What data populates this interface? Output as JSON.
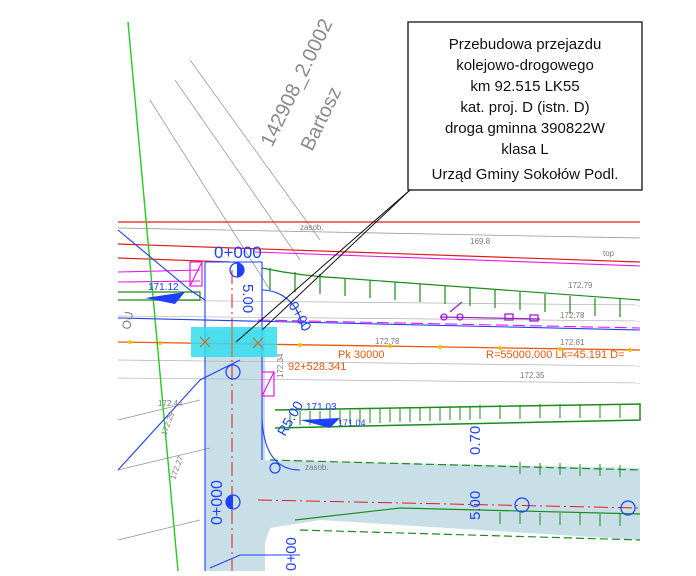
{
  "title_block": {
    "lines": [
      "Przebudowa przejazdu",
      "kolejowo-drogowego",
      "km 92.515 LK55",
      "kat. proj. D (istn. D)",
      "droga gminna 390822W",
      "klasa L",
      "Urząd Gminy Sokołów Podl."
    ]
  },
  "labels": {
    "parcel_number": "142908_2.0002",
    "parcel_owner": "Bartosz",
    "chainage_top": "0+000",
    "width_top": "5.00",
    "curve_left": "R5.00",
    "chainage_left": "0+000",
    "chainage_bottom": "0+00",
    "width_bottom": "5.00",
    "offset_right": "0.70",
    "km_mark": "92+528.341",
    "pk_label": "Pk 30000",
    "radius_label": "R=55000.000 Lk=45.191 D=",
    "elev_blue_1": "171.12",
    "elev_blue_2": "171.03",
    "elev_blue_3": "171.04",
    "elev_grey_1": "172.79",
    "elev_grey_2": "172.78",
    "elev_grey_3": "172.34",
    "elev_grey_4": "172.35",
    "elev_grey_5": "172.81",
    "elev_grey_6": "169.8",
    "elev_grey_7": "172.44",
    "elev_grey_8": "172.29",
    "elev_grey_9": "172.27",
    "zasob_1": "zasob.",
    "zasob_2": "zasob.",
    "top_label": "top",
    "ou_label": "OU"
  },
  "colors": {
    "red": "#e31a1a",
    "magenta": "#e619e6",
    "green": "#1a8c1a",
    "bright_green": "#22cc22",
    "blue": "#1e40ff",
    "cyan": "#33ddee",
    "road_fill": "#c9dfe8",
    "orange": "#e8590c",
    "grey": "#8a8a8a",
    "purple": "#9b1fd1",
    "black": "#111111"
  }
}
